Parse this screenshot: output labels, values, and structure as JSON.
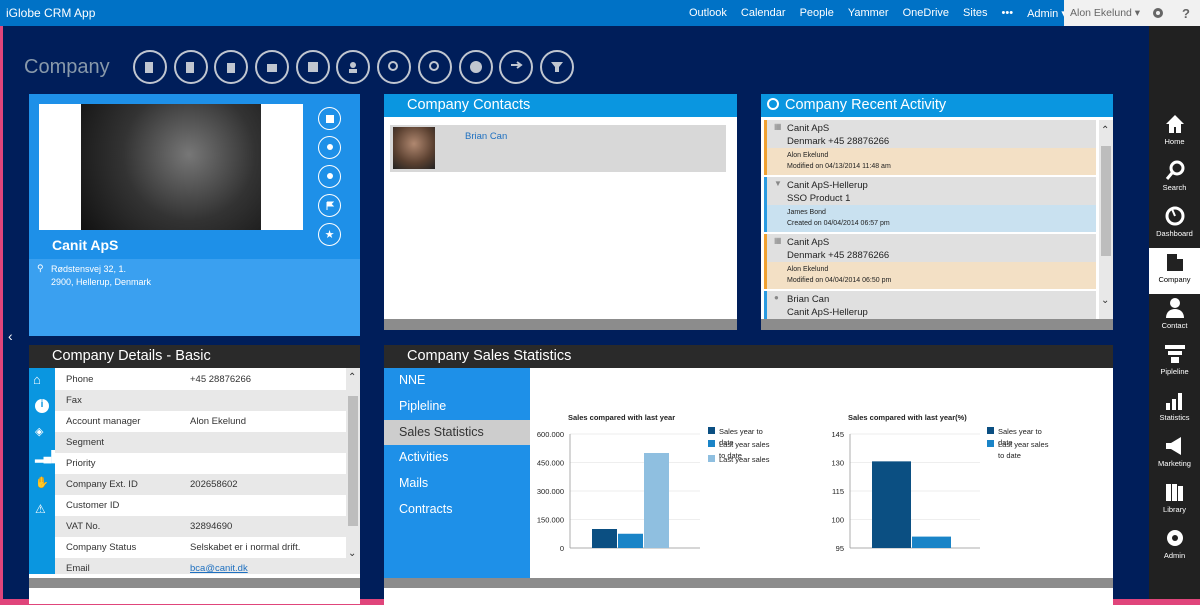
{
  "topbar": {
    "app_title": "iGlobe CRM App",
    "nav": [
      "Outlook",
      "Calendar",
      "People",
      "Yammer",
      "OneDrive",
      "Sites",
      "•••",
      "Admin ▾"
    ],
    "user": "Alon Ekelund ▾"
  },
  "page": {
    "title": "Company"
  },
  "toolbar_icons": [
    "company-add-icon",
    "company-edit-icon",
    "delete-icon",
    "company-move-icon",
    "company-export-icon",
    "contact-add-icon",
    "search-person-icon",
    "search-company-icon",
    "globe-icon",
    "transfer-icon",
    "pipeline-add-icon"
  ],
  "company_card": {
    "name": "Canit ApS",
    "address_line1": "Rødstensvej 32, 1.",
    "address_line2": "2900, Hellerup, Denmark"
  },
  "contacts": {
    "title": "Company Contacts",
    "items": [
      {
        "name": "Brian Can"
      }
    ]
  },
  "activity": {
    "title": "Company Recent Activity",
    "items": [
      {
        "title": "Canit ApS",
        "subtitle": "Denmark +45 28876266",
        "user": "Alon Ekelund",
        "modified": "Modified on 04/13/2014 11:48 am",
        "color": "#f0a030",
        "bg": "#f3e0c5"
      },
      {
        "title": "Canit ApS-Hellerup",
        "subtitle": "SSO Product 1",
        "user": "James Bond",
        "modified": "Created on 04/04/2014 06:57 pm",
        "color": "#2a9ae0",
        "bg": "#c9e1f0"
      },
      {
        "title": "Canit ApS",
        "subtitle": "Denmark +45 28876266",
        "user": "Alon Ekelund",
        "modified": "Modified on 04/04/2014 06:50 pm",
        "color": "#f0a030",
        "bg": "#f3e0c5"
      },
      {
        "title": "Brian Can",
        "subtitle": "Canit ApS-Hellerup",
        "user": "",
        "modified": "",
        "color": "#2a9ae0",
        "bg": "#c9e1f0"
      }
    ]
  },
  "details": {
    "title": "Company Details - Basic",
    "rows": [
      {
        "k": "Phone",
        "v": "+45 28876266"
      },
      {
        "k": "Fax",
        "v": ""
      },
      {
        "k": "Account manager",
        "v": "Alon Ekelund"
      },
      {
        "k": "Segment",
        "v": ""
      },
      {
        "k": "Priority",
        "v": ""
      },
      {
        "k": "Company Ext. ID",
        "v": "202658602"
      },
      {
        "k": "Customer ID",
        "v": ""
      },
      {
        "k": "VAT No.",
        "v": "32894690"
      },
      {
        "k": "Company Status",
        "v": "Selskabet er i normal drift."
      },
      {
        "k": "Email",
        "v": "bca@canit.dk"
      }
    ]
  },
  "stats": {
    "title": "Company Sales Statistics",
    "nav": [
      "NNE",
      "Pipleline",
      "Sales Statistics",
      "Activities",
      "Mails",
      "Contracts"
    ],
    "selected": "Sales Statistics"
  },
  "sidebar": {
    "items": [
      "Home",
      "Search",
      "Dashboard",
      "Company",
      "Contact",
      "Pipleline",
      "Statistics",
      "Marketing",
      "Library",
      "Admin"
    ],
    "active": "Company"
  },
  "chart_data": [
    {
      "type": "bar",
      "title": "Sales compared with last year",
      "ylim": [
        0,
        600000
      ],
      "yticks": [
        "600.000",
        "450.000",
        "300.000",
        "150.000",
        "0"
      ],
      "series": [
        {
          "name": "Sales year to date",
          "values": [
            100000
          ],
          "color": "#0b4f82"
        },
        {
          "name": "Last year sales to date",
          "values": [
            75000
          ],
          "color": "#1a84c7"
        },
        {
          "name": "Last year sales",
          "values": [
            500000
          ],
          "color": "#8fbfe0"
        }
      ]
    },
    {
      "type": "bar",
      "title": "Sales compared with last year(%)",
      "ylim": [
        95,
        145
      ],
      "yticks": [
        "145",
        "130",
        "115",
        "100",
        "95"
      ],
      "series": [
        {
          "name": "Sales year to date",
          "values": [
            133
          ],
          "color": "#0b4f82"
        },
        {
          "name": "Last year sales to date",
          "values": [
            100
          ],
          "color": "#1a84c7"
        }
      ]
    }
  ]
}
